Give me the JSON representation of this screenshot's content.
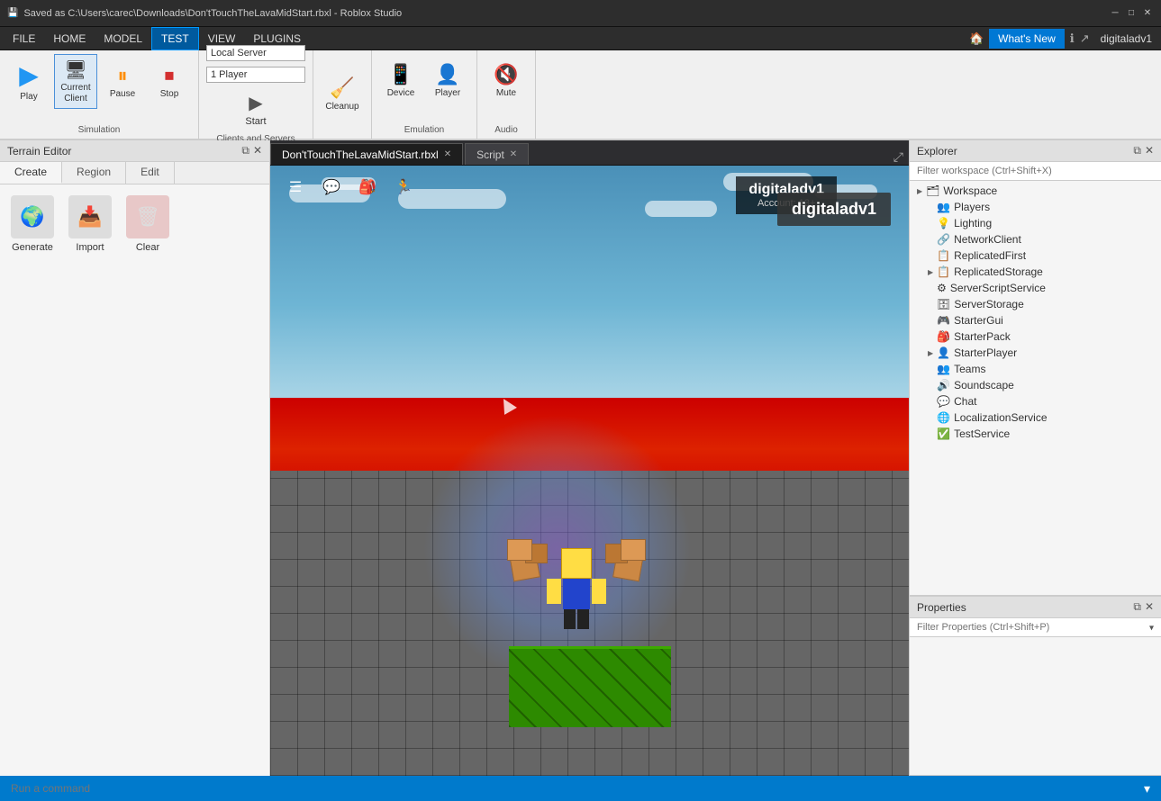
{
  "titlebar": {
    "title": "Saved as C:\\Users\\carec\\Downloads\\Don'tTouchTheLavaMidStart.rbxl - Roblox Studio",
    "save_icon": "💾",
    "win_min": "─",
    "win_max": "□",
    "win_close": "✕"
  },
  "menubar": {
    "items": [
      "FILE",
      "HOME",
      "MODEL",
      "TEST",
      "VIEW",
      "PLUGINS"
    ],
    "active_item": "TEST",
    "whats_new": "What's New",
    "user_icon": "ℹ",
    "share_icon": "↗",
    "username": "digitaladv1"
  },
  "toolbar": {
    "simulation_group": {
      "label": "Simulation",
      "play_label": "Play",
      "current_client_label": "Current\nClient",
      "pause_label": "Pause",
      "stop_label": "Stop"
    },
    "clients_servers_group": {
      "label": "Clients and Servers",
      "local_server_label": "Local Server",
      "player_count_label": "1 Player",
      "start_label": "Start"
    },
    "emulation_group": {
      "label": "Emulation",
      "device_label": "Device",
      "player_label": "Player"
    },
    "audio_group": {
      "label": "Audio",
      "mute_label": "Mute"
    },
    "cleanup_label": "Cleanup"
  },
  "terrain_editor": {
    "title": "Terrain Editor",
    "tabs": [
      "Create",
      "Region",
      "Edit"
    ],
    "active_tab": "Create",
    "tools": [
      {
        "id": "generate",
        "label": "Generate",
        "icon": "🌍"
      },
      {
        "id": "import",
        "label": "Import",
        "icon": "📥"
      },
      {
        "id": "clear",
        "label": "Clear",
        "icon": "🗑"
      }
    ]
  },
  "editor_tabs": [
    {
      "id": "main",
      "label": "Don'tTouchTheLavaMidStart.rbxl",
      "closable": true,
      "active": true
    },
    {
      "id": "script",
      "label": "Script",
      "closable": true,
      "active": false
    }
  ],
  "viewport": {
    "player_name": "digitaladv1",
    "account_label": "Account: 13+",
    "display_name": "digitaladv1",
    "toolbar_icons": [
      "☰",
      "💬",
      "🎒",
      "🏃"
    ]
  },
  "explorer": {
    "title": "Explorer",
    "filter_placeholder": "Filter workspace (Ctrl+Shift+X)",
    "tree": [
      {
        "id": "workspace",
        "label": "Workspace",
        "icon": "🗂",
        "expandable": true,
        "indent": 0
      },
      {
        "id": "players",
        "label": "Players",
        "icon": "👥",
        "expandable": false,
        "indent": 1
      },
      {
        "id": "lighting",
        "label": "Lighting",
        "icon": "💡",
        "expandable": false,
        "indent": 1
      },
      {
        "id": "networkclient",
        "label": "NetworkClient",
        "icon": "🔗",
        "expandable": false,
        "indent": 1
      },
      {
        "id": "replicatedfirst",
        "label": "ReplicatedFirst",
        "icon": "📋",
        "expandable": false,
        "indent": 1
      },
      {
        "id": "replicatedstorage",
        "label": "ReplicatedStorage",
        "icon": "📋",
        "expandable": true,
        "indent": 1
      },
      {
        "id": "serverscriptservice",
        "label": "ServerScriptService",
        "icon": "⚙",
        "expandable": false,
        "indent": 1
      },
      {
        "id": "serverstorage",
        "label": "ServerStorage",
        "icon": "🗄",
        "expandable": false,
        "indent": 1
      },
      {
        "id": "startergui",
        "label": "StarterGui",
        "icon": "🎮",
        "expandable": false,
        "indent": 1
      },
      {
        "id": "starterpack",
        "label": "StarterPack",
        "icon": "🎒",
        "expandable": false,
        "indent": 1
      },
      {
        "id": "starterplayer",
        "label": "StarterPlayer",
        "icon": "👤",
        "expandable": true,
        "indent": 1
      },
      {
        "id": "teams",
        "label": "Teams",
        "icon": "👥",
        "expandable": false,
        "indent": 1
      },
      {
        "id": "soundscape",
        "label": "Soundscape",
        "icon": "🔊",
        "expandable": false,
        "indent": 1
      },
      {
        "id": "chat",
        "label": "Chat",
        "icon": "💬",
        "expandable": false,
        "indent": 1
      },
      {
        "id": "localizationservice",
        "label": "LocalizationService",
        "icon": "🌐",
        "expandable": false,
        "indent": 1
      },
      {
        "id": "testservice",
        "label": "TestService",
        "icon": "✅",
        "expandable": false,
        "indent": 1
      }
    ]
  },
  "properties": {
    "title": "Properties",
    "filter_placeholder": "Filter Properties (Ctrl+Shift+P)"
  },
  "statusbar": {
    "command_placeholder": "Run a command",
    "dropdown_icon": "▾"
  }
}
